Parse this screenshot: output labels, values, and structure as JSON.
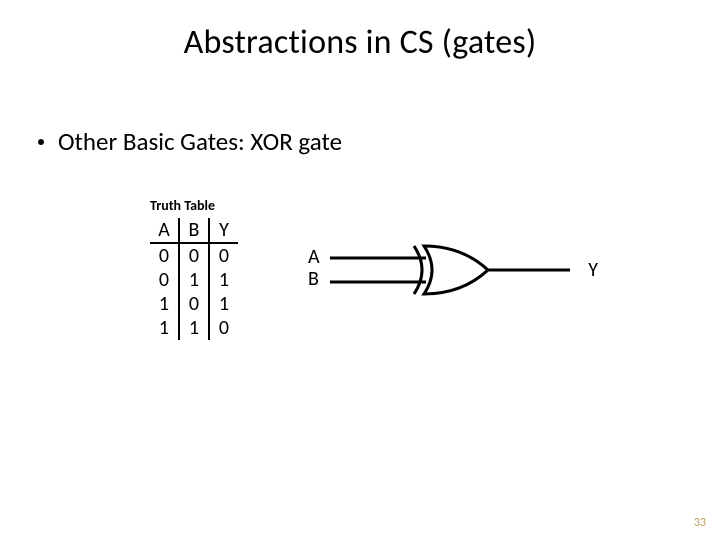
{
  "title": "Abstractions in CS (gates)",
  "bullet_text": "Other Basic Gates: XOR gate",
  "truth_table": {
    "caption": "Truth Table",
    "headers": [
      "A",
      "B",
      "Y"
    ],
    "rows": [
      [
        "0",
        "0",
        "0"
      ],
      [
        "0",
        "1",
        "1"
      ],
      [
        "1",
        "0",
        "1"
      ],
      [
        "1",
        "1",
        "0"
      ]
    ]
  },
  "gate": {
    "input_labels": [
      "A",
      "B"
    ],
    "output_label": "Y",
    "type": "XOR"
  },
  "page_number": "33"
}
